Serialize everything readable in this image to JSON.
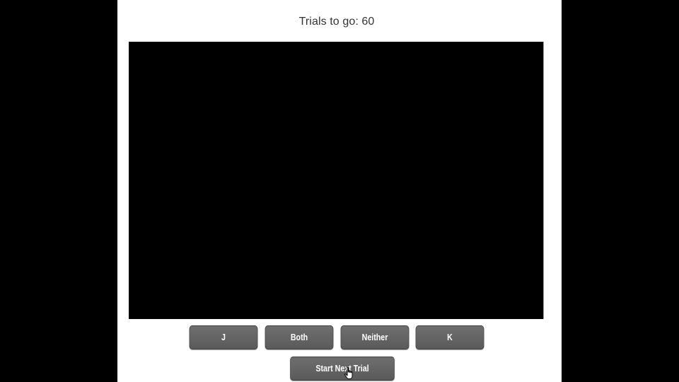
{
  "header": {
    "trials_label": "Trials to go: 60"
  },
  "stimulus": {
    "background": "#000000"
  },
  "responses": {
    "j_label": "J",
    "both_label": "Both",
    "neither_label": "Neither",
    "k_label": "K"
  },
  "controls": {
    "next_label": "Start Next Trial"
  },
  "cursor": {
    "icon": "hand-pointer-icon"
  }
}
